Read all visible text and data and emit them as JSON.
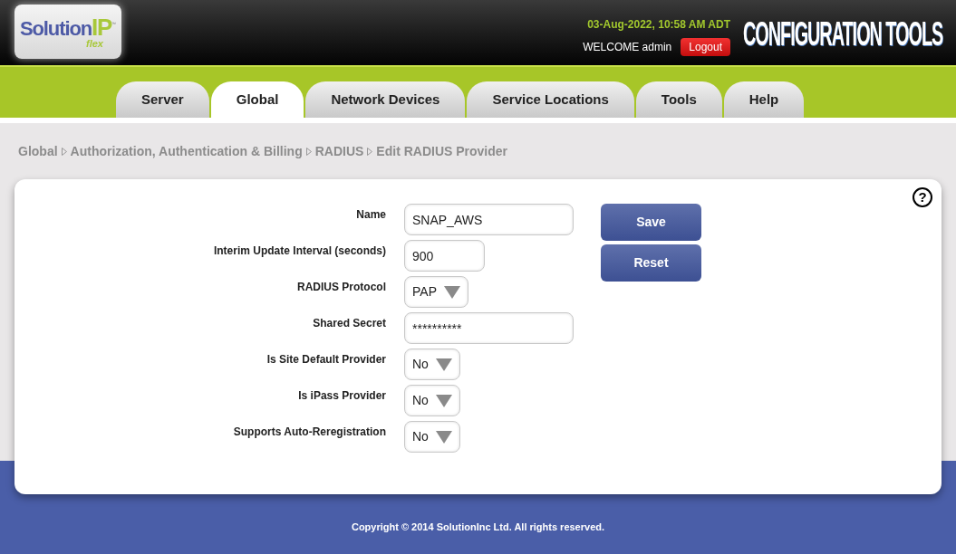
{
  "header": {
    "logo": {
      "word": "Solution",
      "accent": "IP",
      "tm": "™",
      "sub": "flex"
    },
    "datetime": "03-Aug-2022, 10:58 AM ADT",
    "welcome": "WELCOME admin",
    "logout": "Logout",
    "title": "CONFIGURATION TOOLS"
  },
  "tabs": [
    {
      "label": "Server",
      "selected": false
    },
    {
      "label": "Global",
      "selected": true
    },
    {
      "label": "Network Devices",
      "selected": false
    },
    {
      "label": "Service Locations",
      "selected": false
    },
    {
      "label": "Tools",
      "selected": false
    },
    {
      "label": "Help",
      "selected": false
    }
  ],
  "breadcrumb": [
    "Global",
    "Authorization, Authentication & Billing",
    "RADIUS",
    "Edit RADIUS Provider"
  ],
  "help": "?",
  "form": [
    {
      "label": "Name",
      "kind": "text",
      "value": "SNAP_AWS"
    },
    {
      "label": "Interim Update Interval (seconds)",
      "kind": "number",
      "value": "900"
    },
    {
      "label": "RADIUS Protocol",
      "kind": "select",
      "value": "PAP"
    },
    {
      "label": "Shared Secret",
      "kind": "secret",
      "value": "**********"
    },
    {
      "label": "Is Site Default Provider",
      "kind": "select",
      "value": "No"
    },
    {
      "label": "Is iPass Provider",
      "kind": "select",
      "value": "No"
    },
    {
      "label": "Supports Auto-Reregistration",
      "kind": "select",
      "value": "No"
    }
  ],
  "buttons": [
    "Save",
    "Reset"
  ],
  "footer": "Copyright © 2014 SolutionInc Ltd. All rights reserved."
}
